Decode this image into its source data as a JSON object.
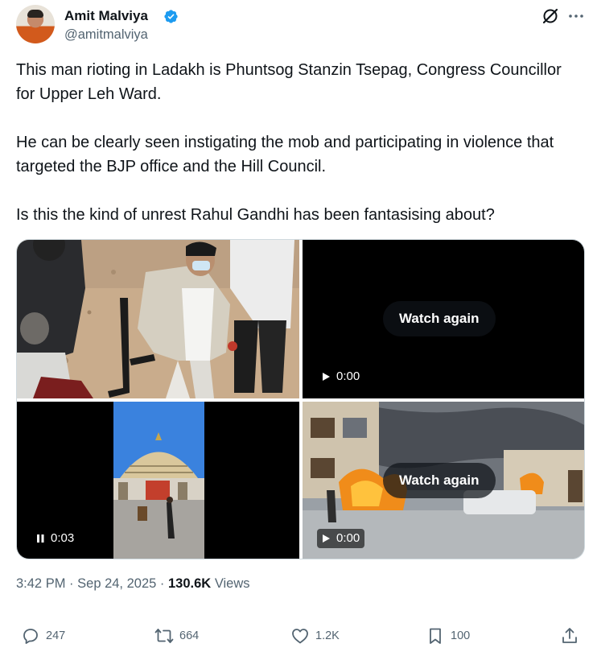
{
  "author": {
    "name": "Amit Malviya",
    "handle": "@amitmalviya"
  },
  "tweet": {
    "text": "This man rioting in Ladakh is Phuntsog Stanzin Tsepag, Congress Councillor for Upper Leh Ward.\n\nHe can be clearly seen instigating the mob and participating in violence that targeted the BJP office and the Hill Council.\n\nIs this the kind of unrest Rahul Gandhi has been fantasising about?"
  },
  "media": {
    "tile2": {
      "button": "Watch again",
      "time": "0:00",
      "state": "play-icon"
    },
    "tile3": {
      "time": "0:03",
      "state": "pause-icon"
    },
    "tile4": {
      "button": "Watch again",
      "time": "0:00",
      "state": "play-icon"
    }
  },
  "meta": {
    "time": "3:42 PM",
    "sep1": "·",
    "date": "Sep 24, 2025",
    "sep2": "·",
    "views_count": "130.6K",
    "views_label": "Views"
  },
  "actions": {
    "replies": "247",
    "reposts": "664",
    "likes": "1.2K",
    "bookmarks": "100"
  },
  "colors": {
    "text": "#0f1419",
    "secondary": "#536471",
    "verified": "#1d9bf0"
  }
}
